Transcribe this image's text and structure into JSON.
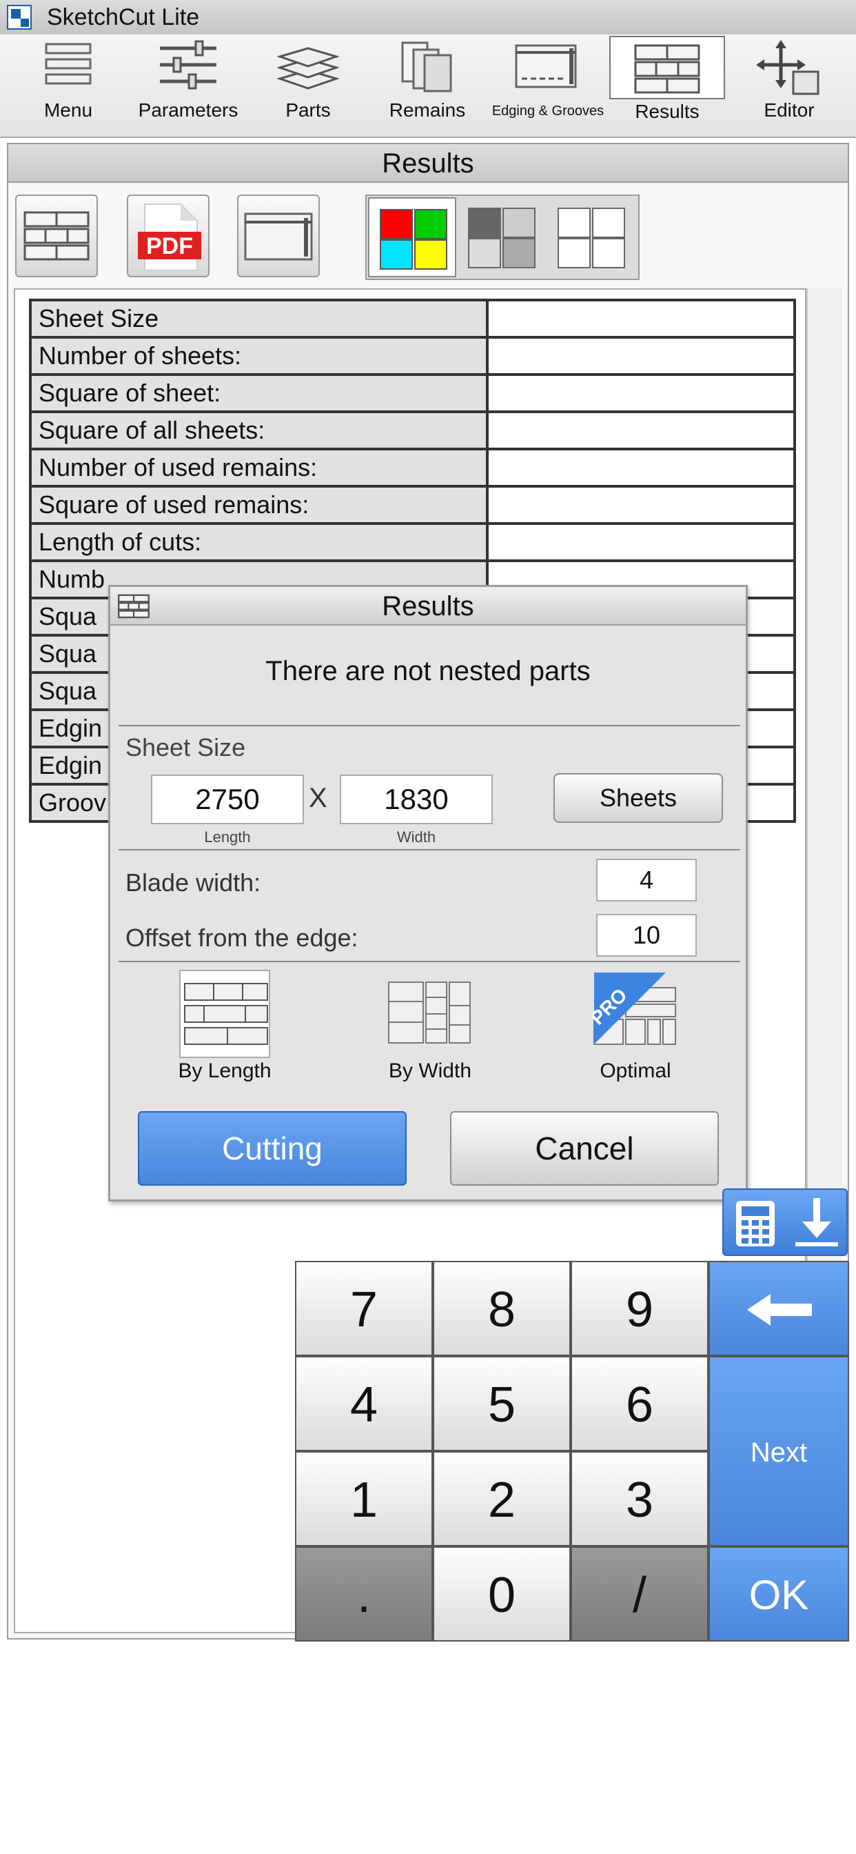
{
  "app": {
    "title": "SketchCut Lite"
  },
  "toolbar": {
    "items": [
      {
        "label": "Menu",
        "icon": "menu-icon"
      },
      {
        "label": "Parameters",
        "icon": "sliders-icon"
      },
      {
        "label": "Parts",
        "icon": "layers-icon"
      },
      {
        "label": "Remains",
        "icon": "remains-icon"
      },
      {
        "label": "Edging & Grooves",
        "icon": "edging-icon"
      },
      {
        "label": "Results",
        "icon": "results-grid-icon",
        "active": true
      },
      {
        "label": "Editor",
        "icon": "move-arrows-icon"
      }
    ]
  },
  "panel": {
    "title": "Results",
    "buttons": [
      "results-grid-icon",
      "pdf-icon",
      "edging-view-icon"
    ],
    "pdf_text": "PDF",
    "color_modes": [
      "color-fill-icon",
      "gray-fill-icon",
      "outline-icon"
    ],
    "colors": {
      "red": "#ff0000",
      "green": "#00cc00",
      "cyan": "#00e5ff",
      "yellow": "#ffff00"
    }
  },
  "stats_table": {
    "rows": [
      {
        "label": "Sheet Size",
        "value": ""
      },
      {
        "label": "Number of sheets:",
        "value": ""
      },
      {
        "label": "Square of sheet:",
        "value": ""
      },
      {
        "label": "Square of all sheets:",
        "value": ""
      },
      {
        "label": "Number of used remains:",
        "value": ""
      },
      {
        "label": "Square of used remains:",
        "value": ""
      },
      {
        "label": "Length of cuts:",
        "value": ""
      },
      {
        "label": "Numb",
        "value": ""
      },
      {
        "label": "Squa",
        "value": ""
      },
      {
        "label": "Squa",
        "value": ""
      },
      {
        "label": "Squa",
        "value": ""
      },
      {
        "label": "Edgin",
        "value": ""
      },
      {
        "label": "Edgin",
        "value": ""
      },
      {
        "label": "Groov",
        "value": ""
      }
    ]
  },
  "dialog": {
    "title": "Results",
    "message": "There are not nested parts",
    "sheet_size_label": "Sheet Size",
    "length_value": "2750",
    "separator": "X",
    "width_value": "1830",
    "length_caption": "Length",
    "width_caption": "Width",
    "sheets_button": "Sheets",
    "blade_label": "Blade width:",
    "blade_value": "4",
    "offset_label": "Offset from the edge:",
    "offset_value": "10",
    "options": [
      {
        "label": "By Length",
        "selected": true
      },
      {
        "label": "By Width",
        "selected": false
      },
      {
        "label": "Optimal",
        "selected": false,
        "badge": "PRO"
      }
    ],
    "cutting_button": "Cutting",
    "cancel_button": "Cancel"
  },
  "keypad": {
    "keys": [
      "7",
      "8",
      "9",
      "4",
      "5",
      "6",
      "1",
      "2",
      "3",
      ".",
      "0",
      "/"
    ],
    "next_label": "Next",
    "ok_label": "OK"
  }
}
